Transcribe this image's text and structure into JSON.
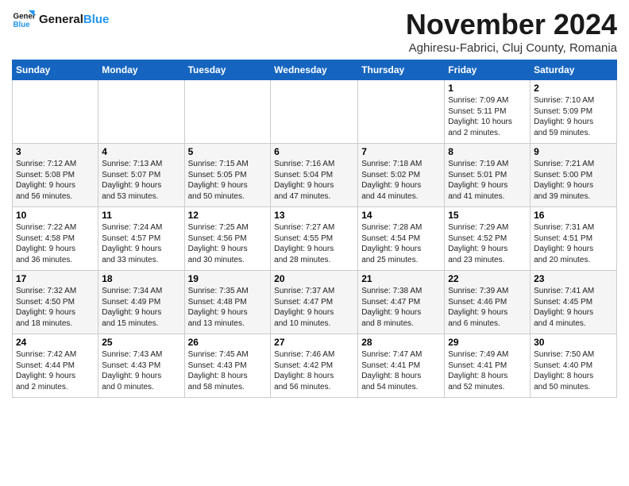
{
  "logo": {
    "line1": "General",
    "line2": "Blue"
  },
  "title": "November 2024",
  "location": "Aghiresu-Fabrici, Cluj County, Romania",
  "days_of_week": [
    "Sunday",
    "Monday",
    "Tuesday",
    "Wednesday",
    "Thursday",
    "Friday",
    "Saturday"
  ],
  "weeks": [
    [
      {
        "day": "",
        "info": ""
      },
      {
        "day": "",
        "info": ""
      },
      {
        "day": "",
        "info": ""
      },
      {
        "day": "",
        "info": ""
      },
      {
        "day": "",
        "info": ""
      },
      {
        "day": "1",
        "info": "Sunrise: 7:09 AM\nSunset: 5:11 PM\nDaylight: 10 hours\nand 2 minutes."
      },
      {
        "day": "2",
        "info": "Sunrise: 7:10 AM\nSunset: 5:09 PM\nDaylight: 9 hours\nand 59 minutes."
      }
    ],
    [
      {
        "day": "3",
        "info": "Sunrise: 7:12 AM\nSunset: 5:08 PM\nDaylight: 9 hours\nand 56 minutes."
      },
      {
        "day": "4",
        "info": "Sunrise: 7:13 AM\nSunset: 5:07 PM\nDaylight: 9 hours\nand 53 minutes."
      },
      {
        "day": "5",
        "info": "Sunrise: 7:15 AM\nSunset: 5:05 PM\nDaylight: 9 hours\nand 50 minutes."
      },
      {
        "day": "6",
        "info": "Sunrise: 7:16 AM\nSunset: 5:04 PM\nDaylight: 9 hours\nand 47 minutes."
      },
      {
        "day": "7",
        "info": "Sunrise: 7:18 AM\nSunset: 5:02 PM\nDaylight: 9 hours\nand 44 minutes."
      },
      {
        "day": "8",
        "info": "Sunrise: 7:19 AM\nSunset: 5:01 PM\nDaylight: 9 hours\nand 41 minutes."
      },
      {
        "day": "9",
        "info": "Sunrise: 7:21 AM\nSunset: 5:00 PM\nDaylight: 9 hours\nand 39 minutes."
      }
    ],
    [
      {
        "day": "10",
        "info": "Sunrise: 7:22 AM\nSunset: 4:58 PM\nDaylight: 9 hours\nand 36 minutes."
      },
      {
        "day": "11",
        "info": "Sunrise: 7:24 AM\nSunset: 4:57 PM\nDaylight: 9 hours\nand 33 minutes."
      },
      {
        "day": "12",
        "info": "Sunrise: 7:25 AM\nSunset: 4:56 PM\nDaylight: 9 hours\nand 30 minutes."
      },
      {
        "day": "13",
        "info": "Sunrise: 7:27 AM\nSunset: 4:55 PM\nDaylight: 9 hours\nand 28 minutes."
      },
      {
        "day": "14",
        "info": "Sunrise: 7:28 AM\nSunset: 4:54 PM\nDaylight: 9 hours\nand 25 minutes."
      },
      {
        "day": "15",
        "info": "Sunrise: 7:29 AM\nSunset: 4:52 PM\nDaylight: 9 hours\nand 23 minutes."
      },
      {
        "day": "16",
        "info": "Sunrise: 7:31 AM\nSunset: 4:51 PM\nDaylight: 9 hours\nand 20 minutes."
      }
    ],
    [
      {
        "day": "17",
        "info": "Sunrise: 7:32 AM\nSunset: 4:50 PM\nDaylight: 9 hours\nand 18 minutes."
      },
      {
        "day": "18",
        "info": "Sunrise: 7:34 AM\nSunset: 4:49 PM\nDaylight: 9 hours\nand 15 minutes."
      },
      {
        "day": "19",
        "info": "Sunrise: 7:35 AM\nSunset: 4:48 PM\nDaylight: 9 hours\nand 13 minutes."
      },
      {
        "day": "20",
        "info": "Sunrise: 7:37 AM\nSunset: 4:47 PM\nDaylight: 9 hours\nand 10 minutes."
      },
      {
        "day": "21",
        "info": "Sunrise: 7:38 AM\nSunset: 4:47 PM\nDaylight: 9 hours\nand 8 minutes."
      },
      {
        "day": "22",
        "info": "Sunrise: 7:39 AM\nSunset: 4:46 PM\nDaylight: 9 hours\nand 6 minutes."
      },
      {
        "day": "23",
        "info": "Sunrise: 7:41 AM\nSunset: 4:45 PM\nDaylight: 9 hours\nand 4 minutes."
      }
    ],
    [
      {
        "day": "24",
        "info": "Sunrise: 7:42 AM\nSunset: 4:44 PM\nDaylight: 9 hours\nand 2 minutes."
      },
      {
        "day": "25",
        "info": "Sunrise: 7:43 AM\nSunset: 4:43 PM\nDaylight: 9 hours\nand 0 minutes."
      },
      {
        "day": "26",
        "info": "Sunrise: 7:45 AM\nSunset: 4:43 PM\nDaylight: 8 hours\nand 58 minutes."
      },
      {
        "day": "27",
        "info": "Sunrise: 7:46 AM\nSunset: 4:42 PM\nDaylight: 8 hours\nand 56 minutes."
      },
      {
        "day": "28",
        "info": "Sunrise: 7:47 AM\nSunset: 4:41 PM\nDaylight: 8 hours\nand 54 minutes."
      },
      {
        "day": "29",
        "info": "Sunrise: 7:49 AM\nSunset: 4:41 PM\nDaylight: 8 hours\nand 52 minutes."
      },
      {
        "day": "30",
        "info": "Sunrise: 7:50 AM\nSunset: 4:40 PM\nDaylight: 8 hours\nand 50 minutes."
      }
    ]
  ]
}
